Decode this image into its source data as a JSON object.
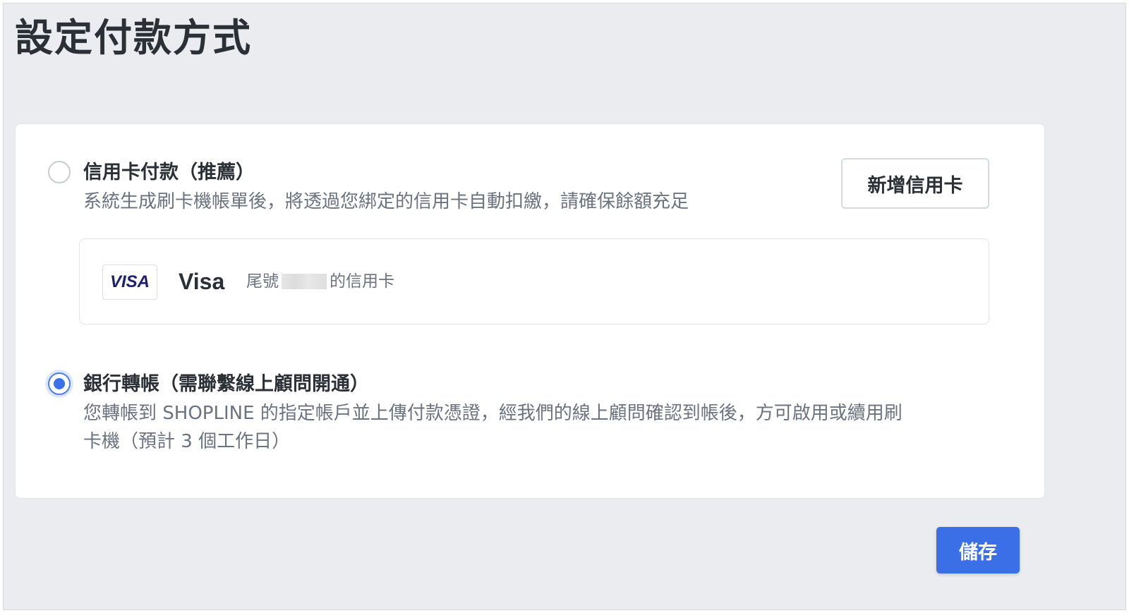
{
  "page": {
    "title": "設定付款方式"
  },
  "payment_options": [
    {
      "title": "信用卡付款（推薦）",
      "description": "系統生成刷卡機帳單後，將透過您綁定的信用卡自動扣繳，請確保餘額充足",
      "selected": false,
      "add_button_label": "新增信用卡",
      "saved_card": {
        "logo_text": "VISA",
        "brand": "Visa",
        "prefix": "尾號",
        "suffix": "的信用卡"
      }
    },
    {
      "title": "銀行轉帳（需聯繫線上顧問開通）",
      "description_line1": "您轉帳到 SHOPLINE 的指定帳戶並上傳付款憑證，經我們的線上顧問確認到帳後，方可啟用或續用刷",
      "description_line2": "卡機（預計 3 個工作日）",
      "selected": true
    }
  ],
  "footer": {
    "save_label": "儲存"
  },
  "colors": {
    "primary": "#3b6fe8",
    "background": "#ebecf0",
    "visa_blue": "#1a1f71"
  }
}
